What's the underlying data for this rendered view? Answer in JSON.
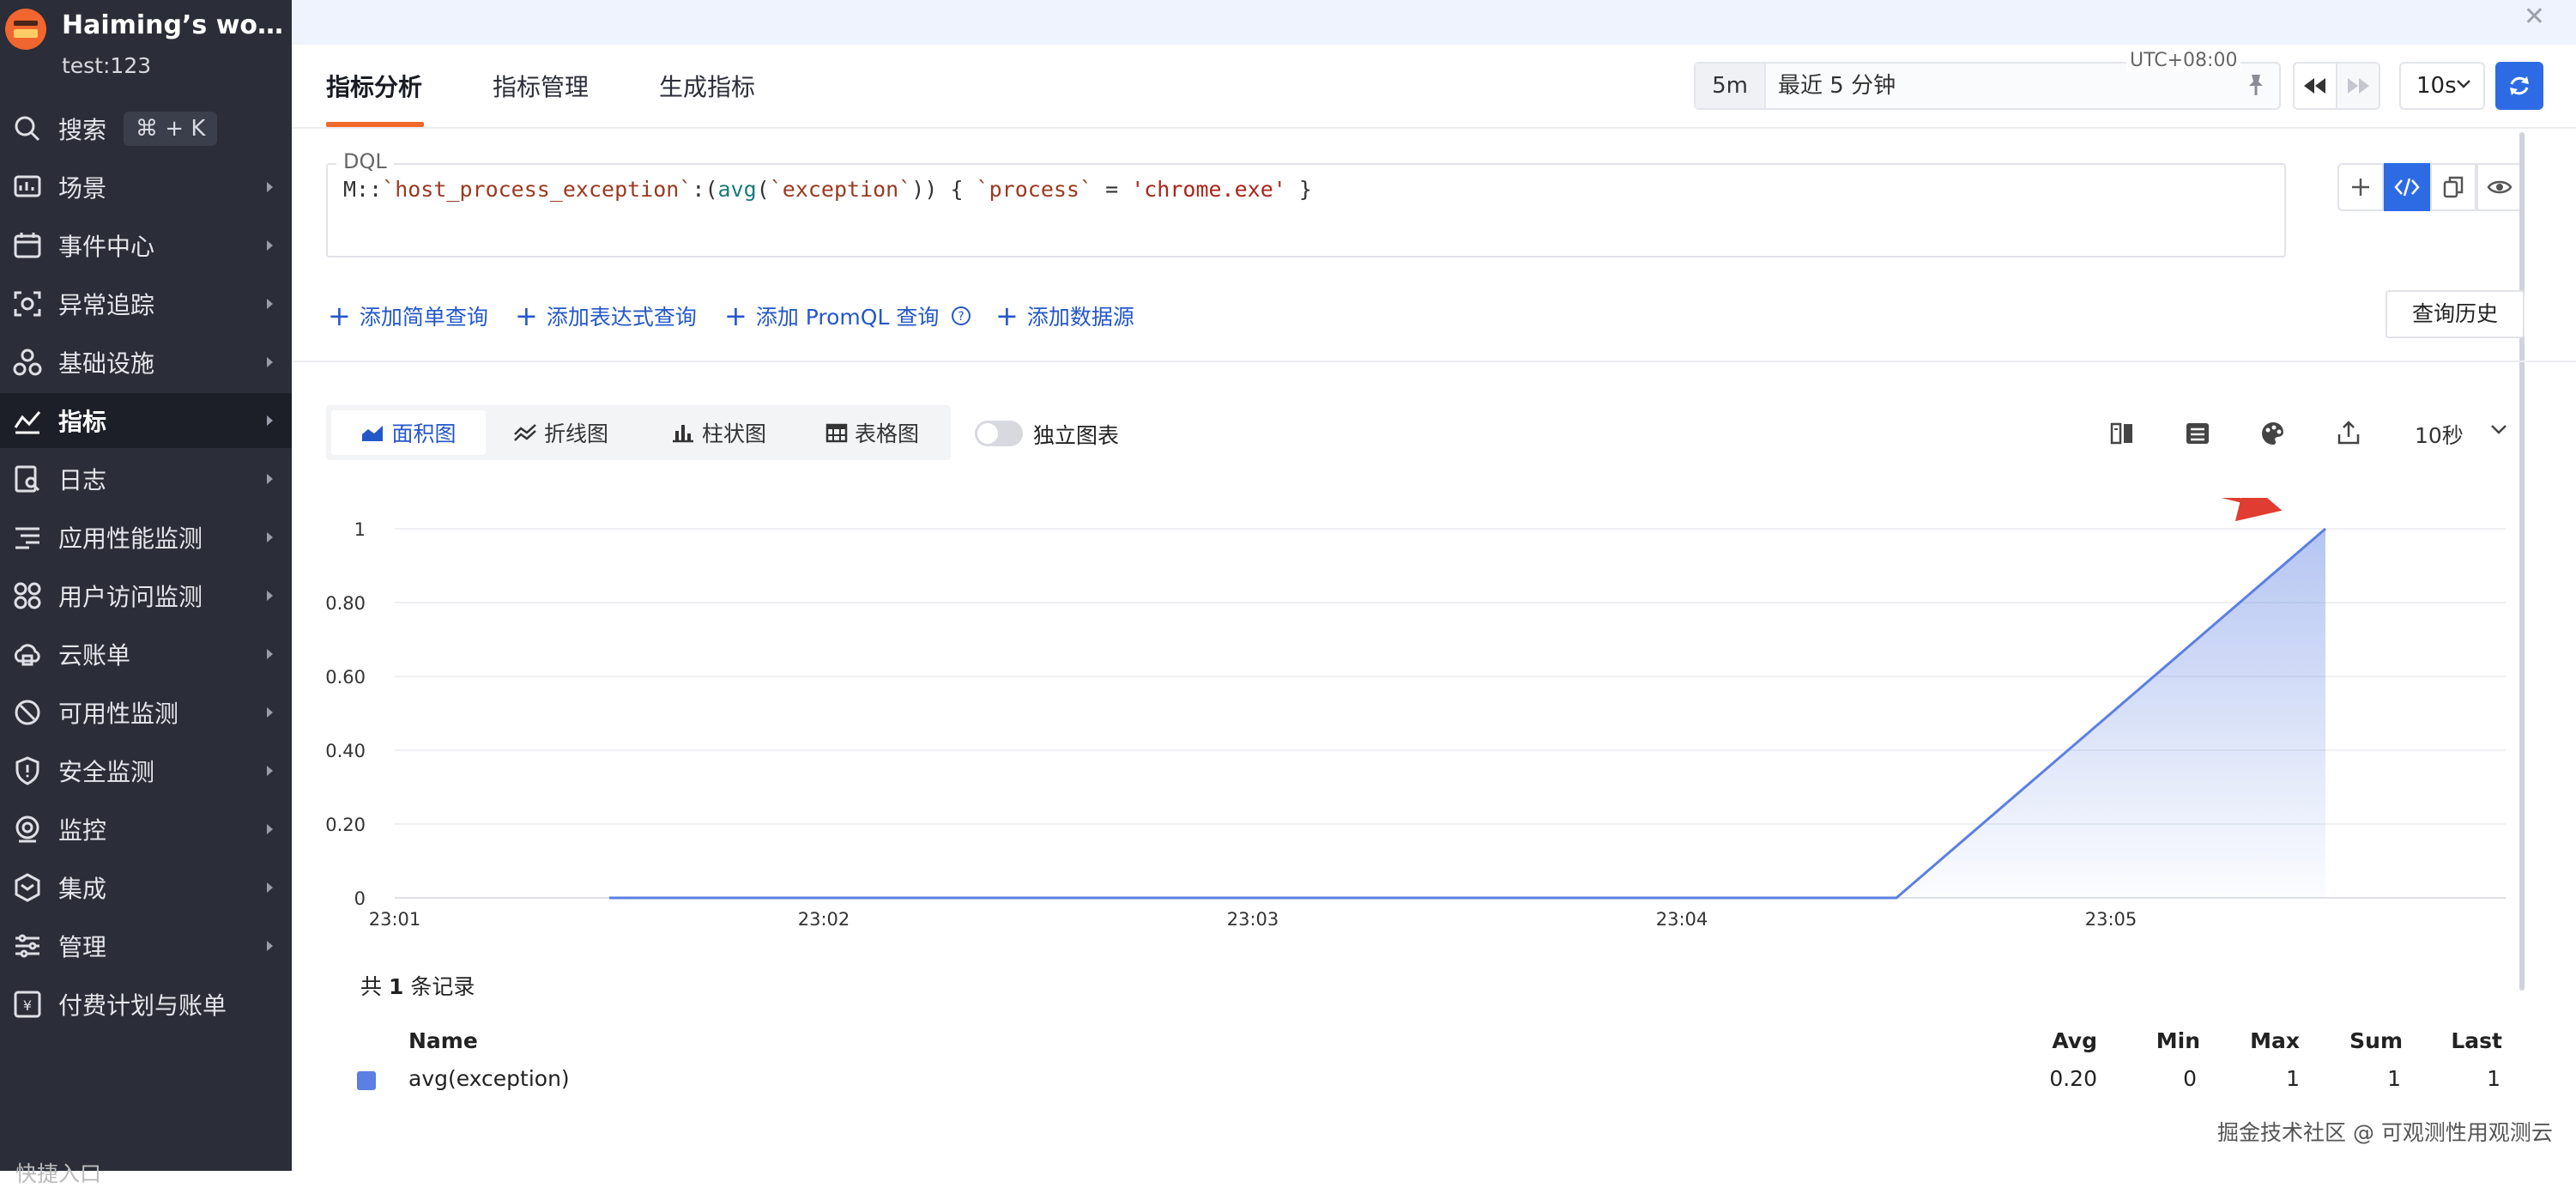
{
  "workspace": {
    "name": "Haiming’s work...",
    "user": "test:123"
  },
  "sidebar": {
    "search": {
      "label": "搜索",
      "shortcut": "⌘ + K"
    },
    "items": [
      {
        "label": "场景",
        "icon": "dashboard-icon"
      },
      {
        "label": "事件中心",
        "icon": "calendar-icon"
      },
      {
        "label": "异常追踪",
        "icon": "scan-icon"
      },
      {
        "label": "基础设施",
        "icon": "nodes-icon"
      },
      {
        "label": "指标",
        "icon": "metrics-icon",
        "active": true
      },
      {
        "label": "日志",
        "icon": "log-icon"
      },
      {
        "label": "应用性能监测",
        "icon": "trace-icon"
      },
      {
        "label": "用户访问监测",
        "icon": "grid-icon"
      },
      {
        "label": "云账单",
        "icon": "cloud-icon"
      },
      {
        "label": "可用性监测",
        "icon": "gauge-icon"
      },
      {
        "label": "安全监测",
        "icon": "shield-icon"
      },
      {
        "label": "监控",
        "icon": "camera-icon"
      },
      {
        "label": "集成",
        "icon": "integration-icon"
      },
      {
        "label": "管理",
        "icon": "sliders-icon"
      },
      {
        "label": "付费计划与账单",
        "icon": "bill-icon"
      }
    ],
    "footer_partial": "快捷入口"
  },
  "tabs": [
    {
      "label": "指标分析",
      "active": true
    },
    {
      "label": "指标管理"
    },
    {
      "label": "生成指标"
    }
  ],
  "time": {
    "short": "5m",
    "range": "最近 5 分钟",
    "timezone": "UTC+08:00",
    "interval": "10s"
  },
  "dql": {
    "label": "DQL",
    "query": "M::`host_process_exception`:(avg(`exception`)) { `process` = 'chrome.exe' }"
  },
  "add_links": [
    {
      "label": "添加简单查询"
    },
    {
      "label": "添加表达式查询"
    },
    {
      "label": "添加 PromQL 查询"
    },
    {
      "label": "添加数据源"
    }
  ],
  "history_label": "查询历史",
  "chart_types": [
    {
      "label": "面积图",
      "active": true
    },
    {
      "label": "折线图"
    },
    {
      "label": "柱状图"
    },
    {
      "label": "表格图"
    }
  ],
  "independent_chart": {
    "label": "独立图表",
    "on": false
  },
  "chart_interval": "10秒",
  "chart_data": {
    "type": "area",
    "title": "",
    "xlabel": "",
    "ylabel": "",
    "x_ticks": [
      "23:01",
      "23:02",
      "23:03",
      "23:04",
      "23:05"
    ],
    "y_ticks": [
      "0",
      "0.20",
      "0.40",
      "0.60",
      "0.80",
      "1"
    ],
    "ylim": [
      0,
      1
    ],
    "xlim_minutes": [
      0.0,
      4.92
    ],
    "series": [
      {
        "name": "avg(exception)",
        "color": "#5b7fe2",
        "points": [
          {
            "x": 0.5,
            "y": 0
          },
          {
            "x": 3.5,
            "y": 0
          },
          {
            "x": 4.5,
            "y": 1
          }
        ]
      }
    ],
    "grid": true,
    "annotation": {
      "type": "arrow",
      "color": "#e03c31"
    }
  },
  "legend_table": {
    "records_prefix": "共",
    "records_count": "1",
    "records_suffix": "条记录",
    "headers": {
      "name": "Name",
      "avg": "Avg",
      "min": "Min",
      "max": "Max",
      "sum": "Sum",
      "last": "Last"
    },
    "rows": [
      {
        "name": "avg(exception)",
        "avg": "0.20",
        "min": "0",
        "max": "1",
        "sum": "1",
        "last": "1"
      }
    ]
  },
  "watermark": "掘金技术社区 @ 可观测性用观测云"
}
